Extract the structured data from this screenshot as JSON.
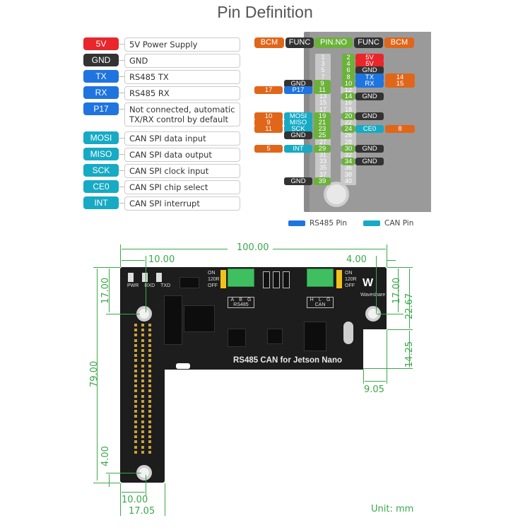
{
  "title": "Pin Definition",
  "legend": [
    {
      "label": "5V",
      "desc": "5V Power Supply",
      "color": "#e8262b"
    },
    {
      "label": "GND",
      "desc": "GND",
      "color": "#333333"
    },
    {
      "label": "TX",
      "desc": "RS485 TX",
      "color": "#1f74e0"
    },
    {
      "label": "RX",
      "desc": "RS485 RX",
      "color": "#1f74e0"
    },
    {
      "label": "P17",
      "desc": "Not connected, automatic TX/RX control by default",
      "color": "#1f74e0"
    },
    {
      "label": "MOSI",
      "desc": "CAN SPI data input",
      "color": "#17aac4"
    },
    {
      "label": "MISO",
      "desc": "CAN SPI data output",
      "color": "#17aac4"
    },
    {
      "label": "SCK",
      "desc": "CAN SPI clock input",
      "color": "#17aac4"
    },
    {
      "label": "CE0",
      "desc": "CAN SPI chip select",
      "color": "#17aac4"
    },
    {
      "label": "INT",
      "desc": "CAN SPI interrupt",
      "color": "#17aac4"
    }
  ],
  "pin_table": {
    "headers": [
      "BCM",
      "FUNC",
      "PIN.NO",
      "FUNC",
      "BCM"
    ],
    "left": [
      {
        "pin": "9",
        "func": "GND",
        "bcm": ""
      },
      {
        "pin": "11",
        "func": "P17",
        "bcm": "17"
      },
      {
        "pin": "19",
        "func": "MOSI",
        "bcm": "10"
      },
      {
        "pin": "21",
        "func": "MISO",
        "bcm": "9"
      },
      {
        "pin": "23",
        "func": "SCK",
        "bcm": "11"
      },
      {
        "pin": "25",
        "func": "GND",
        "bcm": ""
      },
      {
        "pin": "29",
        "func": "INT",
        "bcm": "5"
      },
      {
        "pin": "39",
        "func": "GND",
        "bcm": ""
      }
    ],
    "right": [
      {
        "pin": "2",
        "func": "5V",
        "bcm": ""
      },
      {
        "pin": "4",
        "func": "5V",
        "bcm": ""
      },
      {
        "pin": "6",
        "func": "GND",
        "bcm": ""
      },
      {
        "pin": "8",
        "func": "TX",
        "bcm": "14"
      },
      {
        "pin": "10",
        "func": "RX",
        "bcm": "15"
      },
      {
        "pin": "14",
        "func": "GND",
        "bcm": ""
      },
      {
        "pin": "20",
        "func": "GND",
        "bcm": ""
      },
      {
        "pin": "24",
        "func": "CE0",
        "bcm": "8"
      },
      {
        "pin": "30",
        "func": "GND",
        "bcm": ""
      },
      {
        "pin": "34",
        "func": "GND",
        "bcm": ""
      }
    ],
    "unused_odd": [
      "1",
      "3",
      "5",
      "7",
      "13",
      "15",
      "17",
      "27",
      "31",
      "33",
      "35",
      "37"
    ],
    "unused_even": [
      "12",
      "16",
      "18",
      "22",
      "26",
      "28",
      "32",
      "36",
      "38",
      "40"
    ],
    "key": [
      {
        "label": "RS485 Pin",
        "color": "#1f74e0"
      },
      {
        "label": "CAN Pin",
        "color": "#17aac4"
      }
    ]
  },
  "board": {
    "name": "RS485 CAN for Jetson Nano",
    "brand": "Waveshare",
    "rs485_label": "RS485",
    "rs485_pins": [
      "A",
      "B",
      "G"
    ],
    "can_label": "CAN",
    "can_pins": [
      "H",
      "L",
      "G"
    ],
    "jumper_labels": [
      "ON",
      "120R",
      "OFF"
    ],
    "led_labels": [
      "PWR",
      "RXD",
      "TXD"
    ]
  },
  "dimensions": {
    "width_total": "100.00",
    "hole_left_offset": "10.00",
    "hole_right_offset": "4.00",
    "left_top_hole": "17.00",
    "right_top_hole": "17.00",
    "right_height": "22.67",
    "right_notch": "14.25",
    "notch_width": "9.05",
    "height_total": "79.00",
    "bottom_hole": "4.00",
    "bottom_hole_offset": "10.00",
    "bottom_width": "17.05",
    "unit": "Unit: mm"
  }
}
